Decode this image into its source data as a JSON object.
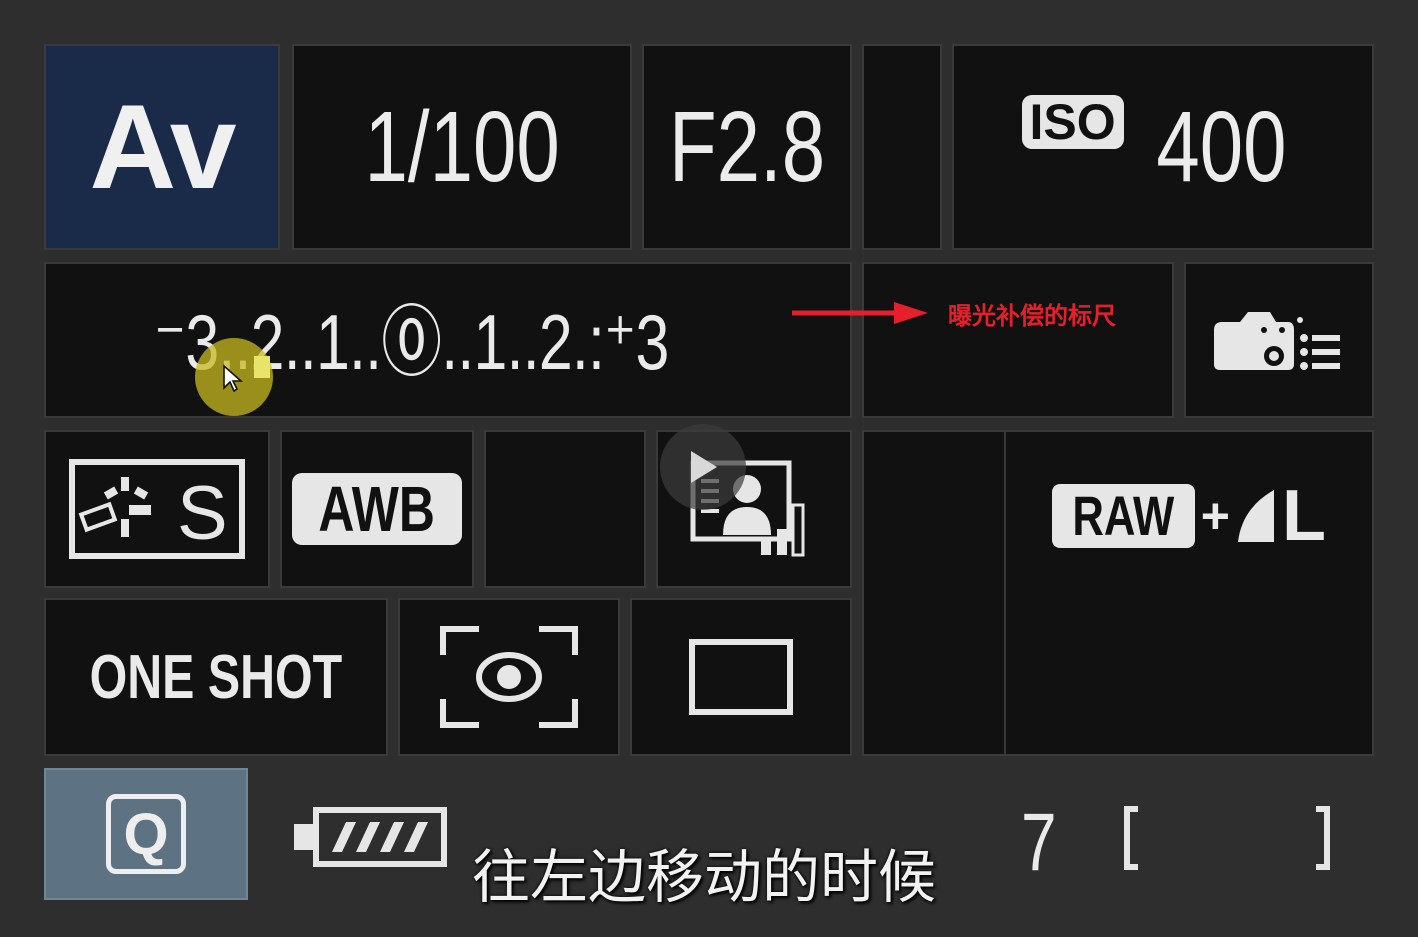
{
  "top_row": {
    "mode": "Av",
    "shutter_speed": "1/100",
    "aperture": "F2.8",
    "iso_label": "ISO",
    "iso_value": "400"
  },
  "exposure_scale": {
    "scale_text": "⁻3..2..1..⓪..1..2.:⁺3",
    "annotation": "曝光补偿的标尺"
  },
  "settings": {
    "white_balance": "AWB",
    "image_quality_raw": "RAW",
    "image_quality_plus": "+",
    "image_quality_size": "L",
    "af_mode": "ONE SHOT"
  },
  "bottom_bar": {
    "q_label": "Q",
    "subtitle": "往左边移动的时候",
    "shots_remaining": "7"
  },
  "colors": {
    "mode_bg": "#1a2b4a",
    "annotation_red": "#e5202b",
    "cursor_highlight": "#c8b91e",
    "q_button_bg": "#5d7282"
  },
  "icons": [
    "picture-style-standard-icon",
    "camera-settings-icon",
    "auto-lighting-optimizer-icon",
    "metering-evaluative-icon",
    "drive-single-icon",
    "battery-icon",
    "play-icon"
  ]
}
